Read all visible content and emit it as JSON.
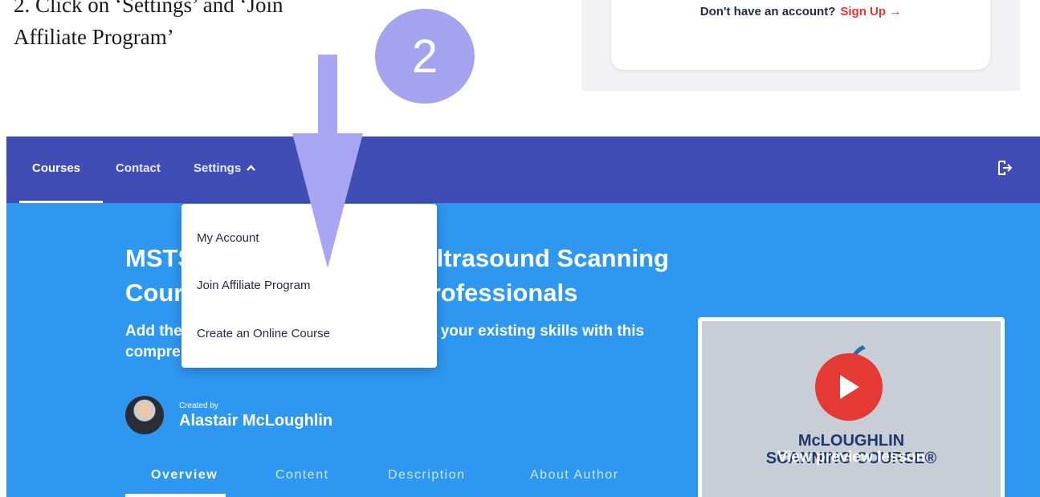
{
  "instruction": {
    "line1": "2. Click on ‘Settings’ and ‘Join",
    "line2": "Affiliate Program’"
  },
  "step_badge": "2",
  "login_card": {
    "prompt": "Don't have an account?",
    "signup_link": "Sign Up →"
  },
  "navbar": {
    "items": [
      "Courses",
      "Contact",
      "Settings"
    ],
    "settings_chevron": "chevron-up-icon",
    "logout_icon": "logout-icon"
  },
  "dropdown": {
    "items": [
      "My Account",
      "Join Affiliate Program",
      "Create an Online Course"
    ]
  },
  "course": {
    "title": "MSTSC Musculoskeletal Ultrasound Scanning Course - For Healthcare Professionals",
    "subtitle": "Add the most in-demand scanning skills to your existing skills with this comprehensive course",
    "created_by_label": "Created by",
    "author": "Alastair McLoughlin"
  },
  "tabs": [
    "Overview",
    "Content",
    "Description",
    "About Author"
  ],
  "preview": {
    "brand_line1": "McLOUGHLIN",
    "brand_line2": "SCANNING COURSE®",
    "label": "View preview lesson"
  },
  "colors": {
    "navbar": "#3f4db5",
    "hero": "#2e97f0",
    "step_circle": "#a3a3f0",
    "signup_link": "#e8342f",
    "play": "#e53935"
  }
}
